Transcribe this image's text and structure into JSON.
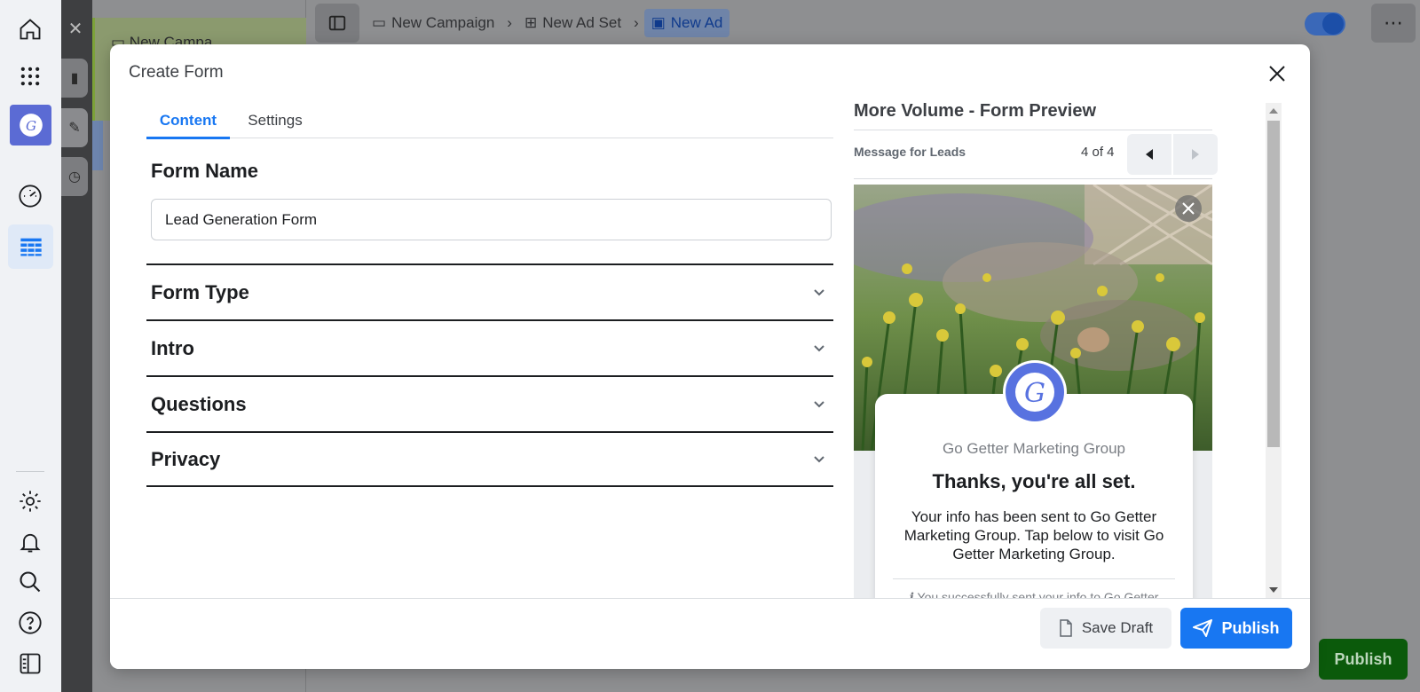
{
  "app": {
    "background_campaign_label": "New Campa",
    "breadcrumbs": [
      {
        "label": "New Campaign",
        "icon": "folder-icon"
      },
      {
        "label": "New Ad Set",
        "icon": "grid-icon"
      },
      {
        "label": "New Ad",
        "icon": "ad-icon"
      }
    ],
    "background_publish_label": "Publish"
  },
  "modal": {
    "title": "Create Form",
    "tabs": [
      {
        "label": "Content",
        "active": true
      },
      {
        "label": "Settings",
        "active": false
      }
    ],
    "form_name": {
      "label": "Form Name",
      "value": "Lead Generation Form"
    },
    "sections": [
      {
        "label": "Form Type"
      },
      {
        "label": "Intro"
      },
      {
        "label": "Questions"
      },
      {
        "label": "Privacy"
      }
    ],
    "preview": {
      "title": "More Volume - Form Preview",
      "step_label": "Message for Leads",
      "counter": "4 of 4",
      "org_name": "Go Getter Marketing Group",
      "headline": "Thanks, you're all set.",
      "body": "Your info has been sent to Go Getter Marketing Group. Tap below to visit Go Getter Marketing Group.",
      "note": "You successfully sent your info to Go Getter Marketing Group"
    },
    "footer": {
      "save_label": "Save Draft",
      "publish_label": "Publish"
    }
  },
  "colors": {
    "accent": "#1877f2",
    "brand_avatar": "#5872e0",
    "bg_publish": "#0b5a0b"
  }
}
